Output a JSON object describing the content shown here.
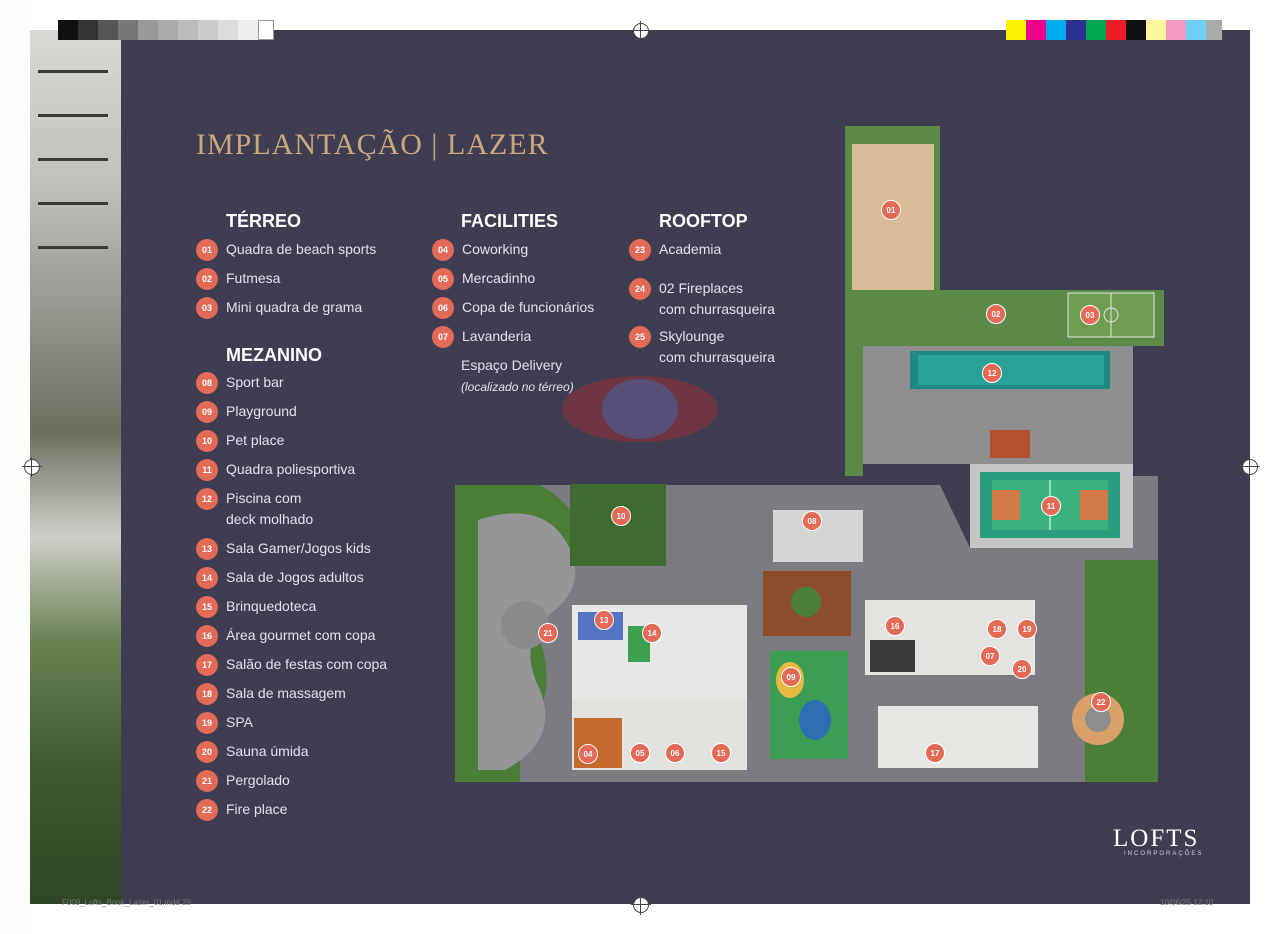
{
  "title": "IMPLANTAÇÃO | LAZER",
  "colors": {
    "background": "#3e3d52",
    "accent": "#c9a87c",
    "badge": "#e26a56",
    "text": "#e3e1ea"
  },
  "sections": {
    "terreo": {
      "heading": "TÉRREO",
      "items": [
        {
          "num": "01",
          "label": "Quadra de beach sports"
        },
        {
          "num": "02",
          "label": "Futmesa"
        },
        {
          "num": "03",
          "label": "Mini quadra de grama"
        }
      ]
    },
    "mezanino": {
      "heading": "MEZANINO",
      "items": [
        {
          "num": "08",
          "label": "Sport bar"
        },
        {
          "num": "09",
          "label": "Playground"
        },
        {
          "num": "10",
          "label": "Pet place"
        },
        {
          "num": "11",
          "label": "Quadra poliesportiva"
        },
        {
          "num": "12",
          "label": "Piscina com",
          "label2": "deck molhado"
        },
        {
          "num": "13",
          "label": "Sala Gamer/Jogos kids"
        },
        {
          "num": "14",
          "label": "Sala de Jogos adultos"
        },
        {
          "num": "15",
          "label": "Brinquedoteca"
        },
        {
          "num": "16",
          "label": "Área gourmet com copa"
        },
        {
          "num": "17",
          "label": "Salão de festas com copa"
        },
        {
          "num": "18",
          "label": "Sala de massagem"
        },
        {
          "num": "19",
          "label": "SPA"
        },
        {
          "num": "20",
          "label": "Sauna úmida"
        },
        {
          "num": "21",
          "label": "Pergolado"
        },
        {
          "num": "22",
          "label": "Fire place"
        }
      ]
    },
    "facilities": {
      "heading": "FACILITIES",
      "items": [
        {
          "num": "04",
          "label": "Coworking"
        },
        {
          "num": "05",
          "label": "Mercadinho"
        },
        {
          "num": "06",
          "label": "Copa de funcionários"
        },
        {
          "num": "07",
          "label": "Lavanderia"
        }
      ],
      "extra": {
        "label": "Espaço Delivery",
        "note": "(localizado no térreo)"
      }
    },
    "rooftop": {
      "heading": "ROOFTOP",
      "items": [
        {
          "num": "23",
          "label": "Academia"
        },
        {
          "num": "24",
          "label": "02 Fireplaces",
          "label2": "com churrasqueira"
        },
        {
          "num": "25",
          "label": "Skylounge",
          "label2": "com churrasqueira"
        }
      ]
    }
  },
  "plan_markers": [
    "01",
    "02",
    "03",
    "04",
    "05",
    "06",
    "07",
    "08",
    "09",
    "10",
    "11",
    "12",
    "13",
    "14",
    "15",
    "16",
    "17",
    "18",
    "19",
    "20",
    "21",
    "22"
  ],
  "logo": {
    "name": "LOFTS",
    "sub": "INCORPORAÇÕES"
  },
  "footer": {
    "left": "F009_Lofts_Book_Lazer_01.indd 29",
    "right": "10/06/25 12:10"
  }
}
